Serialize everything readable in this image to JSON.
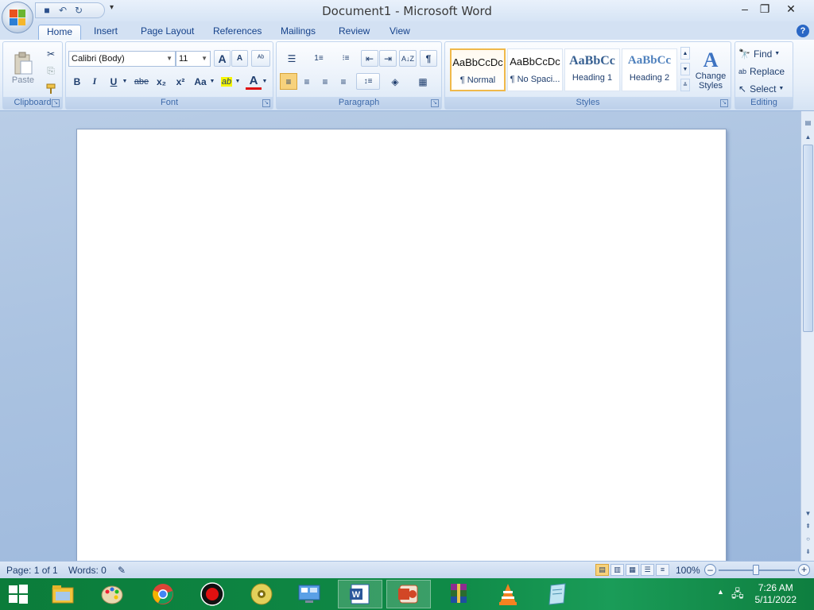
{
  "window": {
    "title": "Document1 - Microsoft Word",
    "minimize": "–",
    "maximize": "❐",
    "close": "✕"
  },
  "quick_access": {
    "save": "💾",
    "undo": "↶",
    "redo": "↻",
    "more": "▾"
  },
  "tabs": [
    "Home",
    "Insert",
    "Page Layout",
    "References",
    "Mailings",
    "Review",
    "View"
  ],
  "active_tab": "Home",
  "help": "?",
  "clipboard": {
    "label": "Clipboard",
    "paste": "Paste",
    "cut_icon": "✂",
    "copy_icon": "⎘",
    "format_painter_icon": "🖌"
  },
  "font": {
    "label": "Font",
    "family": "Calibri (Body)",
    "size": "11",
    "grow": "A",
    "shrink": "A",
    "clear": "ᴬᵇ",
    "bold": "B",
    "italic": "I",
    "underline": "U",
    "strike": "abe",
    "subscript": "x₂",
    "superscript": "x²",
    "change_case": "Aa",
    "highlight": "ab",
    "font_color": "A",
    "highlight_color": "#f5f500",
    "font_color_value": "#e01010"
  },
  "paragraph": {
    "label": "Paragraph",
    "bullets": "☰",
    "numbering": "1≡",
    "multilevel": "⁝≡",
    "decrease_indent": "⇤",
    "increase_indent": "⇥",
    "sort": "A↓Z",
    "show_marks": "¶",
    "align_left": "≡",
    "align_center": "≡",
    "align_right": "≡",
    "justify": "≡",
    "line_spacing": "↕≡",
    "shading": "◈",
    "borders": "▦"
  },
  "styles": {
    "label": "Styles",
    "items": [
      {
        "sample": "AaBbCcDc",
        "name": "¶ Normal"
      },
      {
        "sample": "AaBbCcDc",
        "name": "¶ No Spaci..."
      },
      {
        "sample": "AaBbCc",
        "name": "Heading 1"
      },
      {
        "sample": "AaBbCc",
        "name": "Heading 2"
      }
    ],
    "change_styles_1": "Change",
    "change_styles_2": "Styles"
  },
  "editing": {
    "label": "Editing",
    "find": "Find",
    "replace": "Replace",
    "select": "Select"
  },
  "status": {
    "page": "Page: 1 of 1",
    "words": "Words: 0",
    "zoom": "100%",
    "zoom_out": "–",
    "zoom_in": "+",
    "zoom_level": 0.5
  },
  "taskbar": {
    "time": "7:26 AM",
    "date": "5/11/2022",
    "apps": [
      "windows-start",
      "file-explorer",
      "paint",
      "chrome",
      "screen-recorder",
      "media-disc",
      "control-panel",
      "word",
      "powerpoint",
      "winrar",
      "vlc",
      "notepad"
    ]
  }
}
